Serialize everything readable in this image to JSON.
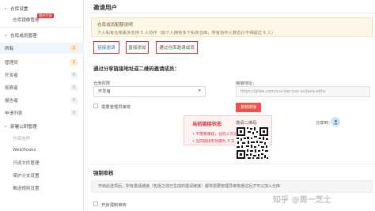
{
  "sidebar": {
    "items": [
      {
        "label": "仓库设置",
        "type": "group"
      },
      {
        "label": "仓库镜像管理",
        "type": "item",
        "badge": "限时开放"
      },
      {
        "label": "仓库成员管理",
        "type": "group"
      },
      {
        "label": "所有",
        "type": "item",
        "count": "1",
        "active": true
      },
      {
        "label": "管理员",
        "type": "item",
        "count": "1"
      },
      {
        "label": "开发者",
        "type": "item",
        "count": "0"
      },
      {
        "label": "观察者",
        "type": "item",
        "count": "0"
      },
      {
        "label": "报告者",
        "type": "item",
        "count": "0"
      },
      {
        "label": "申请列表",
        "type": "item",
        "count": "0"
      },
      {
        "label": "部署公钥管理",
        "type": "group"
      },
      {
        "label": "仓库挂件",
        "type": "item"
      },
      {
        "label": "WebHooks",
        "type": "item"
      },
      {
        "label": "只读文件管理",
        "type": "item"
      },
      {
        "label": "保护分支设置",
        "type": "item"
      },
      {
        "label": "推送规则设置",
        "type": "item"
      }
    ]
  },
  "main": {
    "title": "邀请用户",
    "notice_title": "仓库成员配额说明",
    "notice_text": "个人私有仓库最多支持 5 人协作（如个人拥有多个私有仓库，所有协作人数总计不得超过 5 人）",
    "tabs": [
      {
        "label": "链接邀请",
        "active": true
      },
      {
        "label": "直接添加",
        "active": false
      },
      {
        "label": "通过仓库邀请成员",
        "active": false
      }
    ],
    "share_section_title": "通过分享链接地址或二维码邀请成员：",
    "permission_label": "仓库权限",
    "permission_value": "开发者",
    "require_review_label": "需要管理员审核",
    "warning_title": "当前链接状态",
    "warning_lines": [
      "• 不需要审核，任何人可通过此链接加入",
      "• 当前链接有效期为 3 天"
    ],
    "link_label": "链接地址：",
    "link_value": "https://gitee.com/xxx-bar-xxx-xx/java-abhs",
    "copy_button": "复制链接",
    "qr_label": "邀请二维码",
    "share_label": "分享到：",
    "force_review_title": "强制审核",
    "force_review_text": "开启此选项后，所有邀请链接（包括之前已生成的邀请链接）都将需要管理员审核通过后才可以加入仓库",
    "force_review_checkbox": "开启强制审核",
    "watermark": "知乎 @周一芝士"
  },
  "colors": {
    "accent_red": "#d8303a",
    "copy_button": "#e8534e",
    "notice_bg": "#fdf7e8",
    "active_link": "#2b7bd1"
  },
  "icons": [
    "chevron-down-icon",
    "share-icon",
    "qr-code"
  ]
}
